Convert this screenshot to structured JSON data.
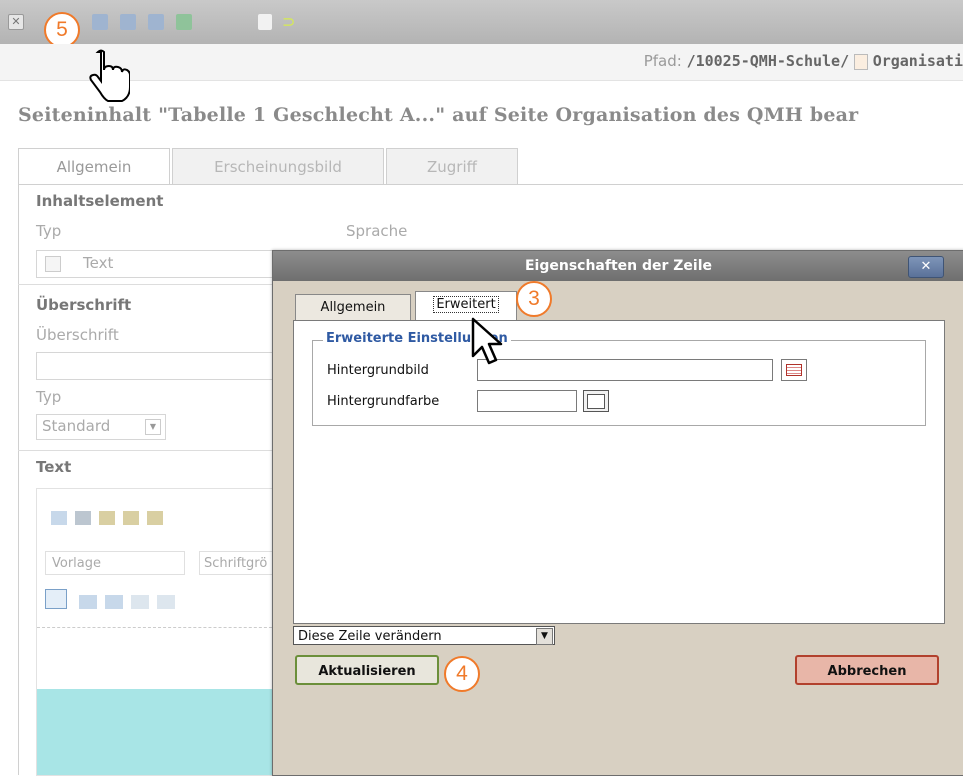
{
  "toolbar": {
    "icons": [
      "close-icon",
      "save-icon",
      "save-view-icon",
      "save-close-icon",
      "save-new-icon",
      "delete-icon",
      "undo-icon"
    ]
  },
  "path": {
    "label": "Pfad:",
    "value": "/10025-QMH-Schule/",
    "page": "Organisati"
  },
  "page_title": "Seiteninhalt \"Tabelle 1   Geschlecht   A...\" auf Seite Organisation des QMH bear",
  "form_tabs": [
    "Allgemein",
    "Erscheinungsbild",
    "Zugriff"
  ],
  "form": {
    "section_content": "Inhaltselement",
    "typ_label": "Typ",
    "sprache_label": "Sprache",
    "typ_value": "Text",
    "section_heading": "Überschrift",
    "heading_label": "Überschrift",
    "heading_typ_label": "Typ",
    "heading_typ_value": "Standard",
    "section_text": "Text",
    "rte_format": "Vorlage",
    "rte_fontsize": "Schriftgrö"
  },
  "dialog": {
    "title": "Eigenschaften der Zeile",
    "close": "✕",
    "tabs": [
      "Allgemein",
      "Erweitert"
    ],
    "legend": "Erweiterte Einstellungen",
    "bg_image_label": "Hintergrundbild",
    "bg_color_label": "Hintergrundfarbe",
    "scope_select": "Diese Zeile verändern",
    "update_button": "Aktualisieren",
    "cancel_button": "Abbrechen"
  },
  "badges": {
    "tab": "3",
    "update": "4",
    "toolbar": "5"
  },
  "colors": {
    "accent_orange": "#f07a2a",
    "legend_blue": "#2f5aa3",
    "rte_cyan": "#a8e5e6"
  }
}
